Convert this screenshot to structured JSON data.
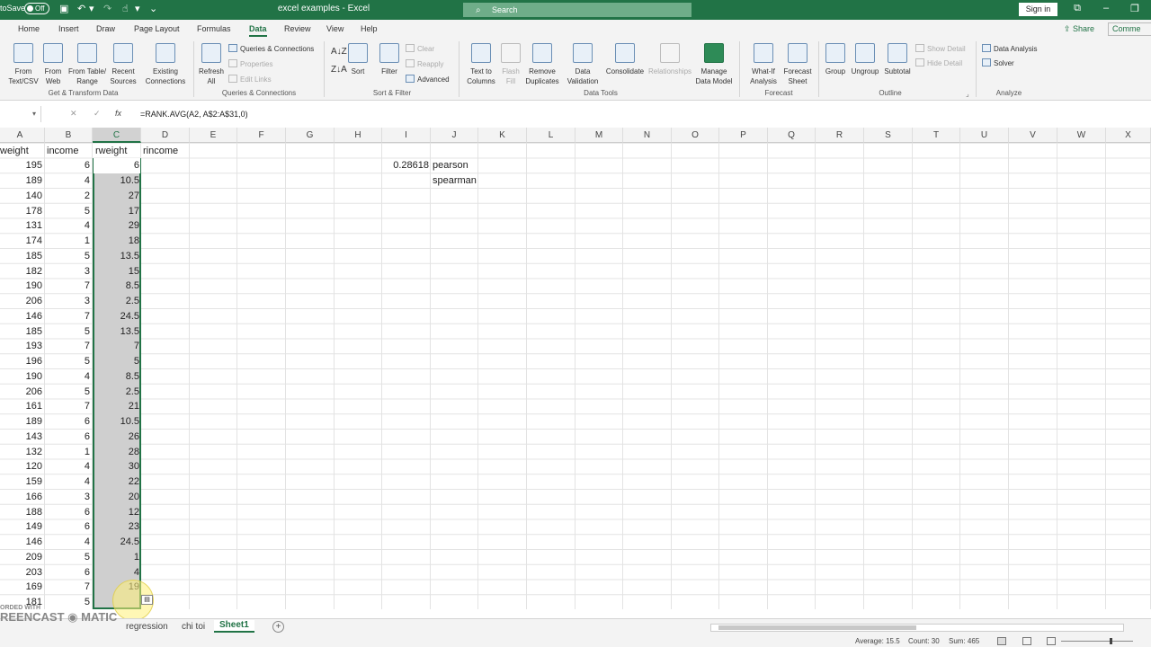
{
  "titlebar": {
    "autosave_label": "toSave",
    "autosave_state": "Off",
    "doc_title": "excel examples - Excel",
    "search_placeholder": "Search",
    "signin": "Sign in"
  },
  "tabs": [
    "Home",
    "Insert",
    "Draw",
    "Page Layout",
    "Formulas",
    "Data",
    "Review",
    "View",
    "Help"
  ],
  "active_tab": "Data",
  "share": "Share",
  "comments": "Comme",
  "ribbon": {
    "from_text": "From\nText/CSV",
    "from_web": "From\nWeb",
    "from_table": "From Table/\nRange",
    "recent_sources": "Recent\nSources",
    "existing_connections": "Existing\nConnections",
    "get_transform_label": "Get & Transform Data",
    "refresh": "Refresh\nAll",
    "queries_connections": "Queries & Connections",
    "properties": "Properties",
    "edit_links": "Edit Links",
    "queries_group_label": "Queries & Connections",
    "sort": "Sort",
    "filter": "Filter",
    "clear": "Clear",
    "reapply": "Reapply",
    "advanced": "Advanced",
    "sort_filter_label": "Sort & Filter",
    "text_to_columns": "Text to\nColumns",
    "flash_fill": "Flash\nFill",
    "remove_duplicates": "Remove\nDuplicates",
    "data_validation": "Data\nValidation",
    "consolidate": "Consolidate",
    "relationships": "Relationships",
    "manage_data_model": "Manage\nData Model",
    "data_tools_label": "Data Tools",
    "what_if": "What-If\nAnalysis",
    "forecast_sheet": "Forecast\nSheet",
    "forecast_label": "Forecast",
    "group": "Group",
    "ungroup": "Ungroup",
    "subtotal": "Subtotal",
    "show_detail": "Show Detail",
    "hide_detail": "Hide Detail",
    "outline_label": "Outline",
    "data_analysis": "Data Analysis",
    "solver": "Solver",
    "analyze_label": "Analyze"
  },
  "formula_bar": {
    "name_box": "",
    "formula": "=RANK.AVG(A2, A$2:A$31,0)"
  },
  "columns": [
    "A",
    "B",
    "C",
    "D",
    "E",
    "F",
    "G",
    "H",
    "I",
    "J",
    "K",
    "L",
    "M",
    "N",
    "O",
    "P",
    "Q",
    "R",
    "S",
    "T",
    "U",
    "V",
    "W",
    "X"
  ],
  "headers": {
    "a": "weight",
    "b": "income",
    "c": "rweight",
    "d": "rincome"
  },
  "rows": [
    {
      "a": "195",
      "b": "6",
      "c": "6"
    },
    {
      "a": "189",
      "b": "4",
      "c": "10.5"
    },
    {
      "a": "140",
      "b": "2",
      "c": "27"
    },
    {
      "a": "178",
      "b": "5",
      "c": "17"
    },
    {
      "a": "131",
      "b": "4",
      "c": "29"
    },
    {
      "a": "174",
      "b": "1",
      "c": "18"
    },
    {
      "a": "185",
      "b": "5",
      "c": "13.5"
    },
    {
      "a": "182",
      "b": "3",
      "c": "15"
    },
    {
      "a": "190",
      "b": "7",
      "c": "8.5"
    },
    {
      "a": "206",
      "b": "3",
      "c": "2.5"
    },
    {
      "a": "146",
      "b": "7",
      "c": "24.5"
    },
    {
      "a": "185",
      "b": "5",
      "c": "13.5"
    },
    {
      "a": "193",
      "b": "7",
      "c": "7"
    },
    {
      "a": "196",
      "b": "5",
      "c": "5"
    },
    {
      "a": "190",
      "b": "4",
      "c": "8.5"
    },
    {
      "a": "206",
      "b": "5",
      "c": "2.5"
    },
    {
      "a": "161",
      "b": "7",
      "c": "21"
    },
    {
      "a": "189",
      "b": "6",
      "c": "10.5"
    },
    {
      "a": "143",
      "b": "6",
      "c": "26"
    },
    {
      "a": "132",
      "b": "1",
      "c": "28"
    },
    {
      "a": "120",
      "b": "4",
      "c": "30"
    },
    {
      "a": "159",
      "b": "4",
      "c": "22"
    },
    {
      "a": "166",
      "b": "3",
      "c": "20"
    },
    {
      "a": "188",
      "b": "6",
      "c": "12"
    },
    {
      "a": "149",
      "b": "6",
      "c": "23"
    },
    {
      "a": "146",
      "b": "4",
      "c": "24.5"
    },
    {
      "a": "209",
      "b": "5",
      "c": "1"
    },
    {
      "a": "203",
      "b": "6",
      "c": "4"
    },
    {
      "a": "169",
      "b": "7",
      "c": "19"
    },
    {
      "a": "181",
      "b": "5",
      "c": ""
    }
  ],
  "side_values": {
    "i2": "0.28618",
    "j2": "pearson",
    "j3": "spearman"
  },
  "sheet_tabs": [
    "regression",
    "chi toi",
    "Sheet1"
  ],
  "active_sheet": "Sheet1",
  "watermark": {
    "line1": "ORDED WITH",
    "line2": "REENCAST",
    "line3": "MATIC"
  },
  "status": {
    "average": "Average: 15.5",
    "count": "Count: 30",
    "sum": "Sum: 465"
  }
}
